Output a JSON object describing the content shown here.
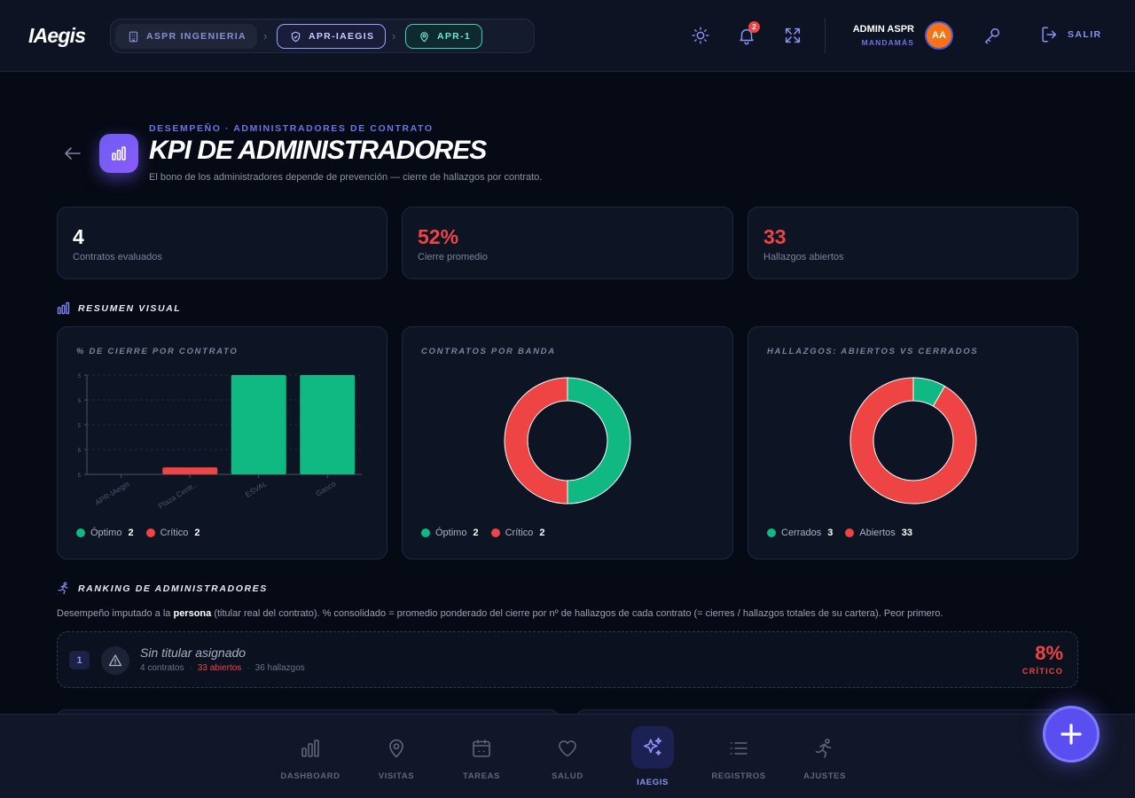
{
  "app": {
    "logo": "IAegis"
  },
  "breadcrumbs": [
    {
      "label": "ASPR INGENIERIA",
      "icon": "building-icon"
    },
    {
      "label": "APR-IAEGIS",
      "icon": "shield-icon"
    },
    {
      "label": "APR-1",
      "icon": "map-pin-icon"
    }
  ],
  "header": {
    "notifications_count": "2",
    "user_name": "ADMIN ASPR",
    "user_role": "MANDAMÁS",
    "avatar_initials": "AA",
    "logout_label": "SALIR"
  },
  "page": {
    "eyebrow": "DESEMPEÑO · ADMINISTRADORES DE CONTRATO",
    "title": "KPI DE ADMINISTRADORES",
    "description": "El bono de los administradores depende de prevención — cierre de hallazgos por contrato."
  },
  "stats": [
    {
      "value": "4",
      "label": "Contratos evaluados",
      "color": "#ffffff"
    },
    {
      "value": "52%",
      "label": "Cierre promedio",
      "color": "#ef4444"
    },
    {
      "value": "33",
      "label": "Hallazgos abiertos",
      "color": "#ef4444"
    }
  ],
  "sections": {
    "visual_title": "RESUMEN VISUAL",
    "ranking_title": "RANKING DE ADMINISTRADORES",
    "ranking_desc_a": "Desempeño imputado a la ",
    "ranking_desc_bold": "persona",
    "ranking_desc_b": " (titular real del contrato). % consolidado = promedio ponderado del cierre por nº de hallazgos de cada contrato (= cierres / hallazgos totales de su cartera). Peor primero."
  },
  "colors": {
    "green": "#10b981",
    "red": "#ef4444",
    "accent": "#6b74e6"
  },
  "chart_data": [
    {
      "type": "bar",
      "title": "% DE CIERRE POR CONTRATO",
      "categories": [
        "APR-IAegis",
        "Plaza Centr...",
        "ESVAL",
        "Gasco"
      ],
      "values": [
        0,
        7,
        100,
        100
      ],
      "bar_colors": [
        "#ef4444",
        "#ef4444",
        "#10b981",
        "#10b981"
      ],
      "ytick_labels": [
        "5",
        "5",
        "5",
        "5",
        "5"
      ],
      "ylim": [
        0,
        100
      ],
      "grid": true,
      "legend": [
        {
          "name": "Óptimo",
          "count": "2",
          "color": "#10b981"
        },
        {
          "name": "Crítico",
          "count": "2",
          "color": "#ef4444"
        }
      ]
    },
    {
      "type": "pie",
      "title": "CONTRATOS POR BANDA",
      "slices": [
        {
          "name": "Óptimo",
          "value": 2,
          "color": "#10b981"
        },
        {
          "name": "Crítico",
          "value": 2,
          "color": "#ef4444"
        }
      ],
      "legend": [
        {
          "name": "Óptimo",
          "count": "2",
          "color": "#10b981"
        },
        {
          "name": "Crítico",
          "count": "2",
          "color": "#ef4444"
        }
      ]
    },
    {
      "type": "pie",
      "title": "HALLAZGOS: ABIERTOS VS CERRADOS",
      "slices": [
        {
          "name": "Cerrados",
          "value": 3,
          "color": "#10b981"
        },
        {
          "name": "Abiertos",
          "value": 33,
          "color": "#ef4444"
        }
      ],
      "legend": [
        {
          "name": "Cerrados",
          "count": "3",
          "color": "#10b981"
        },
        {
          "name": "Abiertos",
          "count": "33",
          "color": "#ef4444"
        }
      ]
    }
  ],
  "ranking": [
    {
      "position": "1",
      "name": "Sin titular asignado",
      "contracts": "4 contratos",
      "open": "33 abiertos",
      "findings": "36 hallazgos",
      "percent": "8%",
      "status": "CRÍTICO"
    }
  ],
  "nav": [
    {
      "label": "DASHBOARD",
      "icon": "bar-chart-icon",
      "active": false
    },
    {
      "label": "VISITAS",
      "icon": "map-pin-icon",
      "active": false
    },
    {
      "label": "TAREAS",
      "icon": "calendar-icon",
      "active": false
    },
    {
      "label": "SALUD",
      "icon": "heart-icon",
      "active": false
    },
    {
      "label": "IAEGIS",
      "icon": "sparkles-icon",
      "active": true
    },
    {
      "label": "REGISTROS",
      "icon": "list-icon",
      "active": false
    },
    {
      "label": "AJUSTES",
      "icon": "runner-icon",
      "active": false
    }
  ]
}
